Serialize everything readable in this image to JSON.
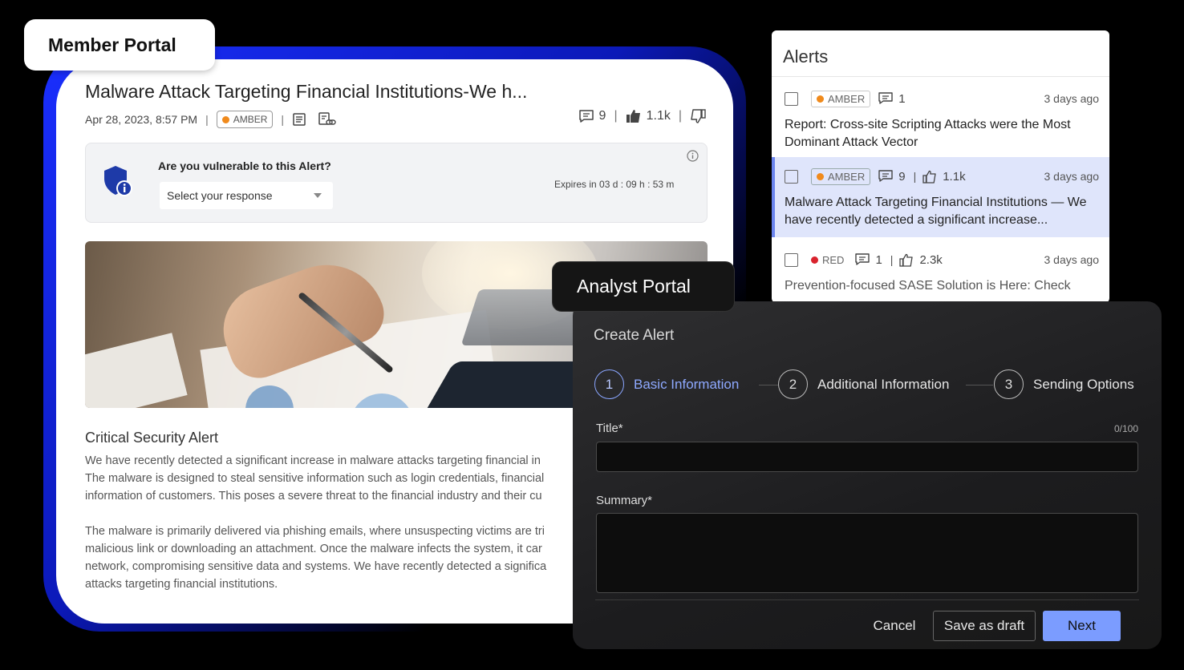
{
  "member": {
    "tag": "Member Portal",
    "title": "Malware Attack Targeting Financial Institutions-We h...",
    "date": "Apr 28, 2023, 8:57 PM",
    "sep": "|",
    "tlp": "AMBER",
    "comments": "9",
    "likes": "1.1k",
    "vuln_question": "Are you vulnerable to this Alert?",
    "vuln_select": "Select your response",
    "expires": "Expires in 03 d : 09 h : 53 m",
    "section_title": "Critical Security Alert",
    "para1": "We have recently detected a significant increase in malware attacks targeting financial in\nThe malware is designed to steal sensitive information such as login credentials, financial\ninformation of customers. This poses a severe threat to the financial industry and their cu",
    "para2": "The malware is primarily delivered via phishing emails, where unsuspecting victims are tri\nmalicious link or downloading an attachment. Once the malware infects the system, it car\nnetwork, compromising sensitive data and systems. We have recently detected a significa\nattacks targeting financial institutions."
  },
  "alerts": {
    "title": "Alerts",
    "items": [
      {
        "tlp": "AMBER",
        "color": "#f08a1c",
        "comments": "1",
        "likes": "",
        "ago": "3 days ago",
        "text": "Report: Cross-site Scripting Attacks were the Most Dominant Attack Vector"
      },
      {
        "tlp": "AMBER",
        "color": "#f08a1c",
        "comments": "9",
        "likes": "1.1k",
        "ago": "3 days ago",
        "text": "Malware Attack Targeting Financial Institutions — We have recently detected a significant increase..."
      },
      {
        "tlp": "RED",
        "color": "#d9232d",
        "comments": "1",
        "likes": "2.3k",
        "ago": "3 days ago",
        "text": "Prevention-focused SASE Solution is Here: Check"
      }
    ]
  },
  "analyst": {
    "tag": "Analyst Portal",
    "title": "Create Alert",
    "steps": [
      {
        "num": "1",
        "label": "Basic Information"
      },
      {
        "num": "2",
        "label": "Additional Information"
      },
      {
        "num": "3",
        "label": "Sending Options"
      }
    ],
    "title_label": "Title*",
    "title_count": "0/100",
    "summary_label": "Summary*",
    "cancel": "Cancel",
    "draft": "Save as draft",
    "next": "Next"
  }
}
